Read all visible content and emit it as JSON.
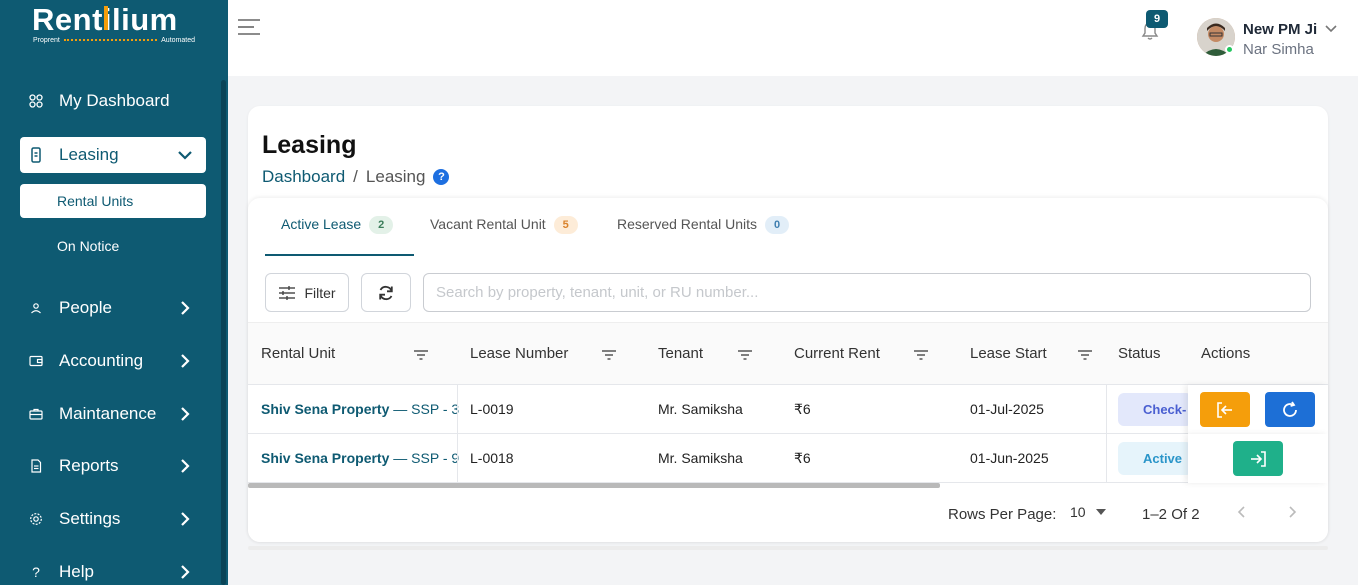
{
  "brand": {
    "name_pre": "Rent",
    "name_i": "i",
    "name_post": "lium",
    "tag_left": "Proprent",
    "tag_right": "Automated",
    "accent_color": "#f59e0b"
  },
  "sidebar": {
    "bg_color": "#0e5a72",
    "items": [
      {
        "label": "My Dashboard",
        "icon": "grid-icon"
      },
      {
        "label": "Leasing",
        "icon": "document-icon",
        "expanded": true
      },
      {
        "label": "People",
        "icon": "person-icon"
      },
      {
        "label": "Accounting",
        "icon": "wallet-icon"
      },
      {
        "label": "Maintanence",
        "icon": "toolbox-icon"
      },
      {
        "label": "Reports",
        "icon": "report-icon"
      },
      {
        "label": "Settings",
        "icon": "gear-icon"
      },
      {
        "label": "Help",
        "icon": "question-icon"
      }
    ],
    "sub_items": [
      {
        "label": "Rental Units",
        "active": true
      },
      {
        "label": "On Notice"
      }
    ]
  },
  "topbar": {
    "notification_count": "9",
    "user_name": "New PM Ji",
    "user_role": "Nar Simha"
  },
  "page": {
    "title": "Leasing",
    "breadcrumb": {
      "root": "Dashboard",
      "sep": "/",
      "current": "Leasing",
      "help": "?"
    }
  },
  "tabs": [
    {
      "label": "Active Lease",
      "count": "2",
      "active": true,
      "badge_bg": "#e3f1e8",
      "badge_fg": "#3b7d5a"
    },
    {
      "label": "Vacant Rental Unit",
      "count": "5",
      "badge_bg": "#fdecd8",
      "badge_fg": "#d9822b"
    },
    {
      "label": "Reserved Rental Units",
      "count": "0",
      "badge_bg": "#e2eef8",
      "badge_fg": "#3f7fb0"
    }
  ],
  "toolbar": {
    "filter_label": "Filter",
    "search_placeholder": "Search by property, tenant, unit, or RU number..."
  },
  "table": {
    "columns": [
      "Rental Unit",
      "Lease Number",
      "Tenant",
      "Current Rent",
      "Lease Start",
      "Status",
      "Actions"
    ],
    "rows": [
      {
        "property": "Shiv Sena Property",
        "unit": " — SSP - 3",
        "lease_number": "L-0019",
        "tenant": "Mr. Samiksha",
        "rent": "₹6",
        "lease_start": "01-Jul-2025",
        "status": "Check-",
        "status_bg": "#e3e8fb",
        "status_fg": "#4a5fd1"
      },
      {
        "property": "Shiv Sena Property",
        "unit": " — SSP - 9",
        "lease_number": "L-0018",
        "tenant": "Mr. Samiksha",
        "rent": "₹6",
        "lease_start": "01-Jun-2025",
        "status": "Active",
        "status_bg": "#e6f4fb",
        "status_fg": "#2a95c9"
      }
    ]
  },
  "pagination": {
    "rows_per_page_label": "Rows Per Page:",
    "rows_per_page": "10",
    "range": "1–2 Of 2"
  },
  "colors": {
    "orange": "#f59e0b",
    "blue": "#1d6fd6",
    "green": "#1fb08a"
  }
}
